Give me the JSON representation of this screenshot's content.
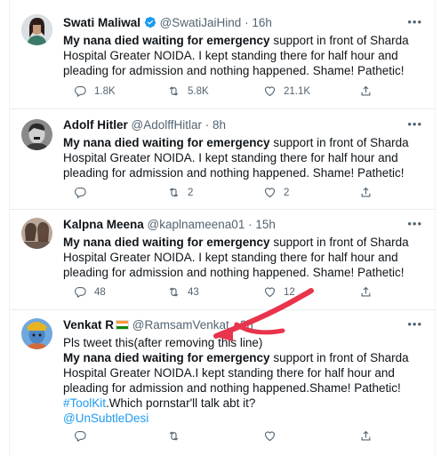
{
  "tweets": [
    {
      "name": "Swati Maliwal",
      "verified": true,
      "handle": "@SwatiJaiHind",
      "sep": "·",
      "time": "16h",
      "more": "•••",
      "bold": "My nana died waiting for emergency",
      "text": " support in front of Sharda Hospital Greater NOIDA. I kept standing there for half hour and pleading for admission and nothing happened. Shame! Pathetic!",
      "reply": "1.8K",
      "retweet": "5.8K",
      "like": "21.1K"
    },
    {
      "name": "Adolf Hitler",
      "handle": "@AdolffHitlar",
      "sep": "·",
      "time": "8h",
      "more": "•••",
      "bold": "My nana died waiting for emergency",
      "text": " support in front of Sharda Hospital Greater NOIDA. I kept standing there for half hour and pleading for admission and nothing happened. Shame! Pathetic!",
      "reply": "",
      "retweet": "2",
      "like": "2"
    },
    {
      "name": "Kalpna Meena",
      "handle": "@kaplnameena01",
      "sep": "·",
      "time": "15h",
      "more": "•••",
      "bold": "My nana died waiting for emergency",
      "text": " support in front of Sharda Hospital Greater NOIDA. I kept standing there for half hour and pleading for admission and nothing happened. Shame! Pathetic!",
      "reply": "48",
      "retweet": "43",
      "like": "12"
    },
    {
      "name": "Venkat R",
      "flag": "india-flag-icon",
      "handle": "@RamsamVenkat",
      "sep": "·",
      "time": "2h",
      "more": "•••",
      "intro": "Pls tweet this(after removing this line)",
      "bold": "My nana died waiting for emergency",
      "text": " support in front of Sharda Hospital Greater NOIDA.I kept standing there for half hour and pleading for admission and nothing happened.Shame! Pathetic!",
      "hashtag": "#ToolKit",
      "after_hashtag": ".Which pornstar'll talk abt it?",
      "mention": "@UnSubtleDesi"
    }
  ],
  "colors": {
    "accent": "#1d9bf0",
    "muted": "#536471",
    "annotation": "#e8344c"
  }
}
